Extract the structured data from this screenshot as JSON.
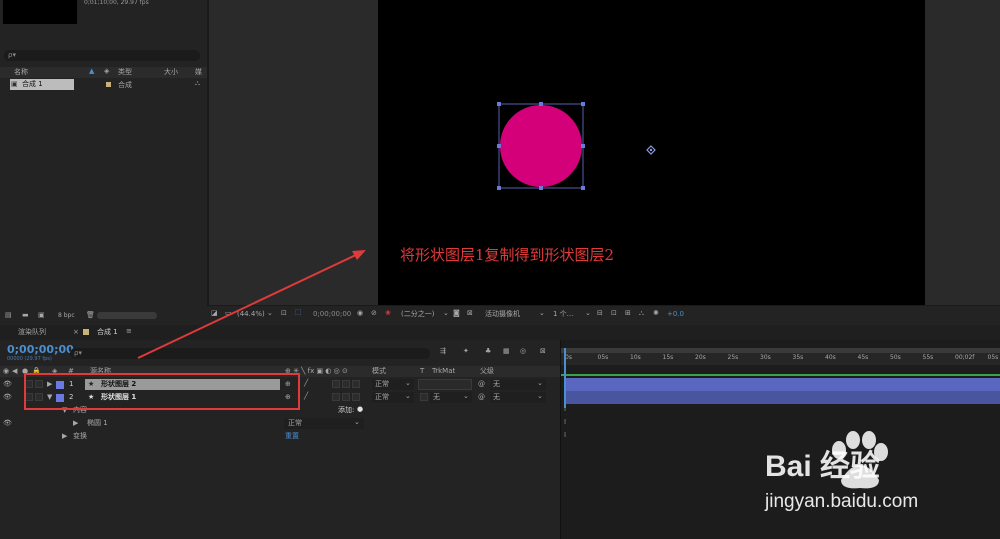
{
  "project": {
    "comp_info": "0;01;10;00, 29.97 fps",
    "header_name": "名称",
    "header_type": "类型",
    "header_size": "大小",
    "header_fps": "媒",
    "item_name": "合成 1",
    "item_type": "合成",
    "bpc": "8 bpc"
  },
  "viewer": {
    "zoom": "(44.4%)",
    "timecode": "0;00;00;00",
    "resolution": "(二分之一)",
    "camera": "活动摄像机",
    "views": "1 个...",
    "exposure": "+0.0",
    "annotation": "将形状图层1复制得到形状图层2",
    "circle_color": "#d4007a"
  },
  "tabs": {
    "render_queue": "渲染队列",
    "comp": "合成 1"
  },
  "timeline": {
    "timecode": "0;00;00;00",
    "fps_sub": "00000 (29.97 fps)",
    "search_placeholder": "ρ▾",
    "col_num": "#",
    "col_source": "源名称",
    "col_mode": "模式",
    "col_t": "T",
    "col_trkmat": "TrkMat",
    "col_parent": "父级",
    "layers": [
      {
        "num": "1",
        "name": "形状图层 2",
        "mode": "正常",
        "trkmat": "",
        "parent": "无"
      },
      {
        "num": "2",
        "name": "形状图层 1",
        "mode": "正常",
        "trkmat": "无",
        "parent": "无"
      }
    ],
    "contents_label": "内容",
    "add_label": "添加:",
    "ellipse_label": "椭圆 1",
    "ellipse_mode": "正常",
    "transform_label": "变换",
    "reset_label": "重置",
    "ruler_ticks": [
      "0s",
      "05s",
      "10s",
      "15s",
      "20s",
      "25s",
      "30s",
      "35s",
      "40s",
      "45s",
      "50s",
      "55s",
      "00;02f",
      "05s"
    ]
  },
  "watermark": {
    "brand": "Bai 经验",
    "url": "jingyan.baidu.com"
  }
}
